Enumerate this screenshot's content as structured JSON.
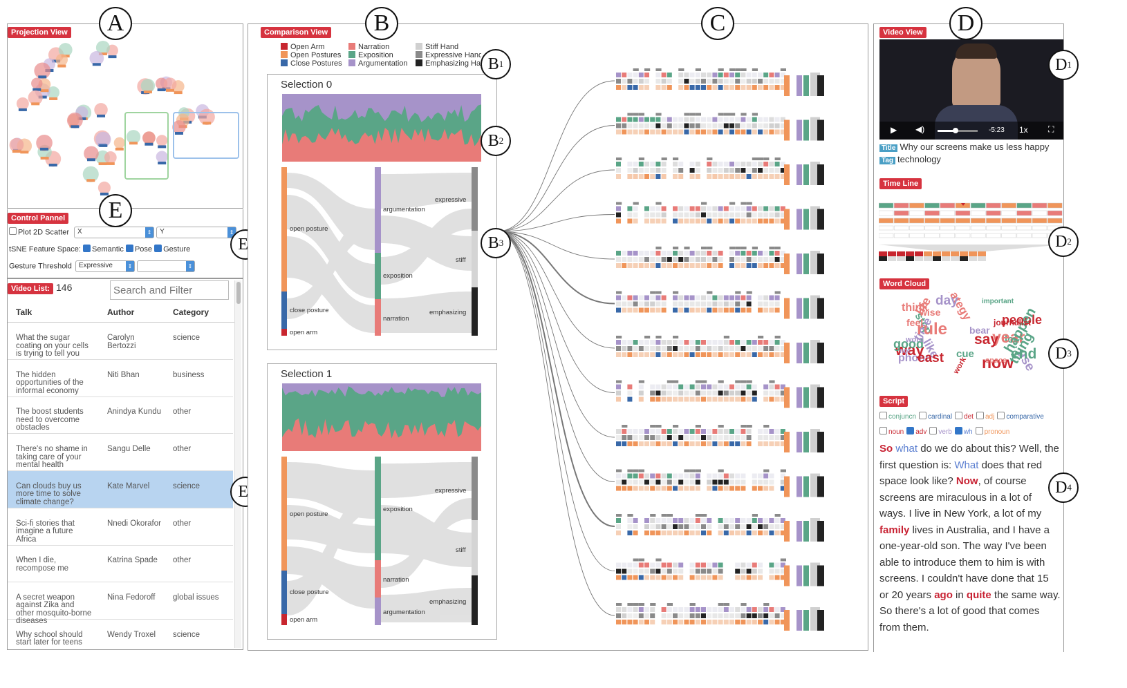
{
  "labels": {
    "A": "A",
    "B": "B",
    "C": "C",
    "D": "D",
    "E": "E",
    "B1": "B",
    "B2": "B",
    "B3": "B",
    "D1": "D",
    "D2": "D",
    "D3": "D",
    "D4": "D",
    "E1": "E",
    "E2": "E",
    "sub1": "1",
    "sub2": "2",
    "sub3": "3",
    "sub4": "4"
  },
  "projection": {
    "title": "Projection View"
  },
  "control": {
    "title": "Control Pannel",
    "plot_label": "Plot 2D Scatter",
    "x_select": "X",
    "y_select": "Y",
    "tsne_label": "tSNE Feature Space:",
    "semantic": "Semantic",
    "pose": "Pose",
    "gesture": "Gesture",
    "threshold_label": "Gesture Threshold",
    "threshold_value": "Expressive"
  },
  "video_list": {
    "title": "Video List:",
    "count": "146",
    "search_placeholder": "Search and Filter",
    "headers": {
      "talk": "Talk",
      "author": "Author",
      "category": "Category"
    },
    "rows": [
      {
        "talk": "What the sugar coating on your cells is trying to tell you",
        "author": "Carolyn Bertozzi",
        "category": "science"
      },
      {
        "talk": "The hidden opportunities of the informal economy",
        "author": "Niti Bhan",
        "category": "business"
      },
      {
        "talk": "The boost students need to overcome obstacles",
        "author": "Anindya Kundu",
        "category": "other"
      },
      {
        "talk": "There's no shame in taking care of your mental health",
        "author": "Sangu Delle",
        "category": "other"
      },
      {
        "talk": "Can clouds buy us more time to solve climate change?",
        "author": "Kate Marvel",
        "category": "science"
      },
      {
        "talk": "Sci-fi stories that imagine a future Africa",
        "author": "Nnedi Okorafor",
        "category": "other"
      },
      {
        "talk": "When I die, recompose me",
        "author": "Katrina Spade",
        "category": "other"
      },
      {
        "talk": "A secret weapon against Zika and other mosquito-borne diseases",
        "author": "Nina Fedoroff",
        "category": "global issues"
      },
      {
        "talk": "Why school should start later for teens",
        "author": "Wendy Troxel",
        "category": "science"
      }
    ]
  },
  "comparison": {
    "title": "Comparison View",
    "legend": {
      "col1": [
        "Open Arm",
        "Open Postures",
        "Close Postures"
      ],
      "col2": [
        "Narration",
        "Exposition",
        "Argumentation"
      ],
      "col3": [
        "Stiff Hand",
        "Expressive Hand",
        "Emphasizing Hand"
      ]
    },
    "selection0": {
      "title": "Selection 0",
      "nodes": {
        "open_posture": "open posture",
        "close_posture": "close posture",
        "open_arm": "open arm",
        "argumentation": "argumentation",
        "exposition": "exposition",
        "narration": "narration",
        "expressive": "expressive",
        "stiff": "stiff",
        "emphasizing": "emphasizing"
      }
    },
    "selection1": {
      "title": "Selection 1",
      "nodes": {
        "open_posture": "open posture",
        "close_posture": "close posture",
        "open_arm": "open arm",
        "exposition": "exposition",
        "narration": "narration",
        "argumentation": "argumentation",
        "expressive": "expressive",
        "stiff": "stiff",
        "emphasizing": "emphasizing"
      }
    }
  },
  "colors": {
    "open_arm": "#c8262f",
    "open_postures": "#f0955a",
    "close_postures": "#3868a8",
    "narration": "#e87b78",
    "exposition": "#5aa587",
    "argumentation": "#a693c9",
    "stiff": "#d0d0d0",
    "expressive": "#8a8a8a",
    "emphasizing": "#222222",
    "accent": "#d6333f"
  },
  "video": {
    "title": "Video View",
    "time": "-5:23",
    "speed": "1x",
    "title_tag": "Title",
    "title_value": "Why our screens make us less happy",
    "tag_tag": "Tag",
    "tag_value": "technology"
  },
  "timeline": {
    "title": "Time Line"
  },
  "wordcloud": {
    "title": "Word Cloud"
  },
  "script": {
    "title": "Script",
    "filters_row1": [
      "conjuncn",
      "cardinal",
      "det",
      "adj",
      "comparative"
    ],
    "filters_row2": [
      "noun",
      "adv",
      "verb",
      "wh",
      "pronoun"
    ],
    "p1": "So",
    "p2": "what",
    "p3": " do we do about this? Well, the first question is: ",
    "p4": "What",
    "p5": " does that red space look like? ",
    "p6": "Now",
    "p7": ", of course screens are miraculous in a lot of ways. I live in New York, a lot of my ",
    "p8": "family",
    "p9": " lives in Australia, and I have a one-year-old son. The way I've been able to introduce them to him is with screens. I couldn't have done that 15 or 20 years ",
    "p10": "ago",
    "p11": " in ",
    "p12": "quite",
    "p13": " the same way. So there's a lot of good that comes from them."
  },
  "words": [
    "lot",
    "strategy",
    "phone",
    "way",
    "stop",
    "year",
    "use",
    "now",
    "end",
    "think",
    "time",
    "people",
    "good",
    "feel",
    "not",
    "say",
    "happen",
    "space",
    "like",
    "journalist",
    "important",
    "life",
    "day",
    "work",
    "cue",
    "rule",
    "bear",
    "east",
    "thing",
    "wise",
    "word"
  ]
}
